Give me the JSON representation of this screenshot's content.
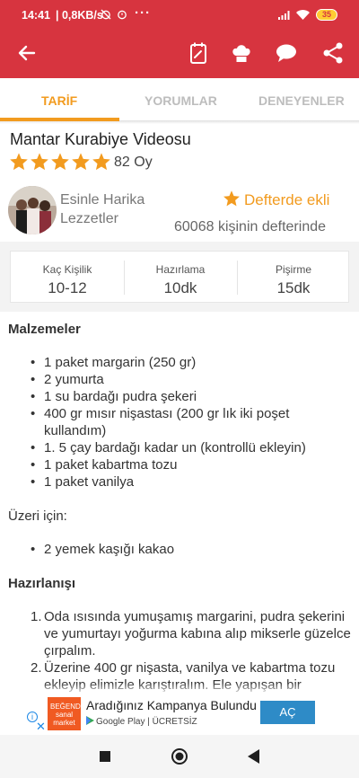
{
  "status_bar": {
    "time": "14:41",
    "network_speed": "| 0,8KB/s",
    "overflow": "···",
    "battery": "35"
  },
  "app_bar": {
    "icons": [
      "back-arrow-icon",
      "notebook-icon",
      "chef-hat-icon",
      "comment-icon",
      "share-icon"
    ],
    "color": "#d7343f"
  },
  "tabs": [
    {
      "label": "TARİF",
      "active": true
    },
    {
      "label": "YORUMLAR",
      "active": false
    },
    {
      "label": "DENEYENLER",
      "active": false
    }
  ],
  "accent_color": "#f29b1f",
  "recipe": {
    "title": "Mantar Kurabiye Videosu",
    "stars": 5,
    "rating_count": "82 Oy",
    "author": "Esinle Harika Lezzetler",
    "favorite_label": "Defterde ekli",
    "favorite_count": "60068 kişinin defterinde"
  },
  "info": {
    "servings": {
      "label": "Kaç Kişilik",
      "value": "10-12"
    },
    "prep": {
      "label": "Hazırlama",
      "value": "10dk"
    },
    "cook": {
      "label": "Pişirme",
      "value": "15dk"
    }
  },
  "ingredients": {
    "heading": "Malzemeler",
    "items": [
      "1 paket margarin (250 gr)",
      "2 yumurta",
      "1 su bardağı pudra şekeri",
      "400 gr mısır nişastası (200 gr lık iki poşet kullandım)",
      "1. 5 çay bardağı kadar un (kontrollü ekleyin)",
      "1 paket kabartma tozu",
      "1 paket vanilya"
    ],
    "topping_label": "Üzeri için:",
    "topping_items": [
      "2 yemek kaşığı kakao"
    ]
  },
  "preparation": {
    "heading": "Hazırlanışı",
    "steps": [
      "Oda ısısında yumuşamış margarini, pudra şekerini ve yumurtayı yoğurma kabına alıp mikserle güzelce çırpalım.",
      "Üzerine 400 gr nişasta, vanilya ve kabartma tozu ekleyip elimizle karıştıralım. Ele yapışan bir"
    ]
  },
  "ad": {
    "logo_text": "BEĞENDİNİZ sanal market",
    "title": "Aradığınız Kampanya Bulundu",
    "store": "Google Play",
    "price": "| ÜCRETSİZ",
    "button": "AÇ"
  }
}
